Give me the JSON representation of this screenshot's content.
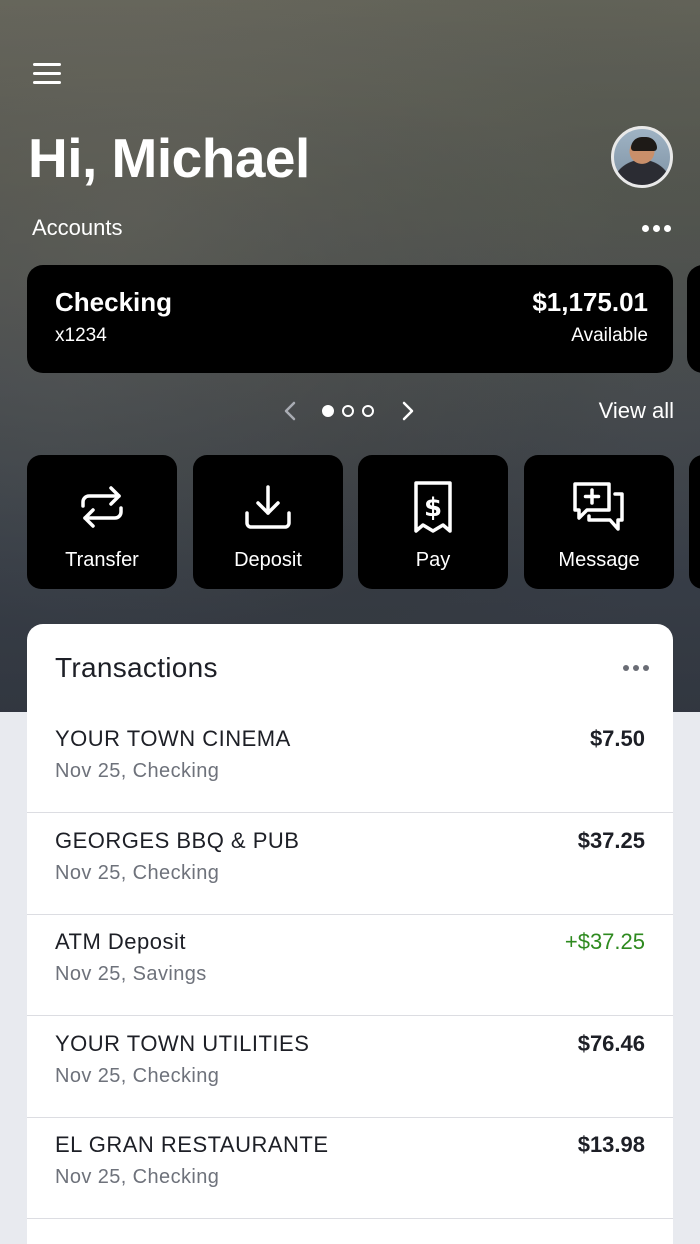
{
  "header": {
    "greeting": "Hi, Michael",
    "accounts_label": "Accounts",
    "view_all": "View all"
  },
  "account": {
    "name": "Checking",
    "number": "x1234",
    "balance": "$1,175.01",
    "balance_label": "Available"
  },
  "pager": {
    "page": 1,
    "total": 3
  },
  "actions": [
    {
      "label": "Transfer",
      "icon": "transfer-icon"
    },
    {
      "label": "Deposit",
      "icon": "deposit-icon"
    },
    {
      "label": "Pay",
      "icon": "pay-icon"
    },
    {
      "label": "Message",
      "icon": "message-icon"
    }
  ],
  "transactions": {
    "title": "Transactions",
    "items": [
      {
        "name": "YOUR TOWN CINEMA",
        "sub": "Nov 25, Checking",
        "amount": "$7.50",
        "credit": false
      },
      {
        "name": "GEORGES BBQ & PUB",
        "sub": "Nov 25, Checking",
        "amount": "$37.25",
        "credit": false
      },
      {
        "name": "ATM Deposit",
        "sub": "Nov 25, Savings",
        "amount": "+$37.25",
        "credit": true
      },
      {
        "name": "YOUR TOWN UTILITIES",
        "sub": "Nov 25, Checking",
        "amount": "$76.46",
        "credit": false
      },
      {
        "name": "EL GRAN RESTAURANTE",
        "sub": "Nov 25, Checking",
        "amount": "$13.98",
        "credit": false
      }
    ]
  },
  "colors": {
    "credit": "#2e8a1f",
    "card": "#000000",
    "text": "#1d1f26"
  }
}
